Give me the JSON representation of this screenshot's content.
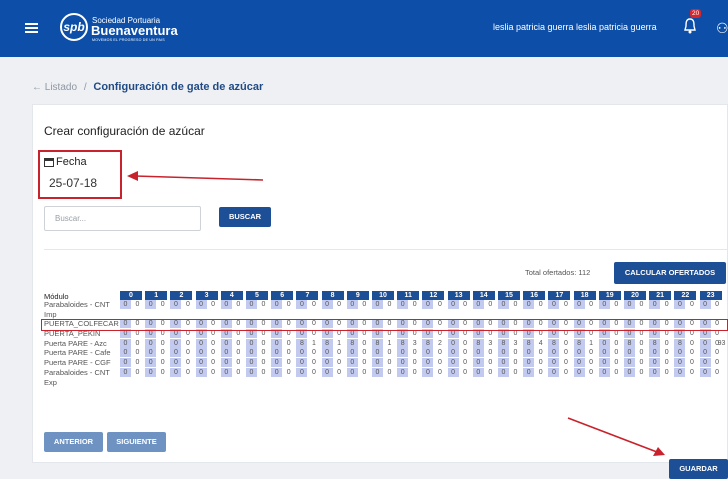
{
  "header": {
    "brand_line1": "Sociedad Portuaria",
    "brand_line2": "Buenaventura",
    "brand_tagline": "MOVEMOS EL PROGRESO DE UN PAIS",
    "logo_text": "spb",
    "user_name": "leslia patricia guerra leslia patricia guerra",
    "notif_count": "20"
  },
  "breadcrumb": {
    "back": "← Listado",
    "sep": "/",
    "current": "Configuración de gate de azúcar"
  },
  "form": {
    "title": "Crear configuración de azúcar",
    "fecha_label": "Fecha",
    "fecha_value": "25-07-18",
    "search_placeholder": "Buscar...",
    "search_button": "BUSCAR",
    "total_text": "Total ofertados: 112",
    "calc_button": "CALCULAR OFERTADOS",
    "prev_button": "ANTERIOR",
    "next_button": "SIGUIENTE",
    "save_button": "GUARDAR"
  },
  "grid": {
    "module_header": "Módulo",
    "hours": [
      "0",
      "1",
      "2",
      "3",
      "4",
      "5",
      "6",
      "7",
      "8",
      "9",
      "10",
      "11",
      "12",
      "13",
      "14",
      "15",
      "16",
      "17",
      "18",
      "19",
      "20",
      "21",
      "22",
      "23"
    ],
    "rows": [
      {
        "label": "Parabaloides - CNT\nImp",
        "values": [
          "0",
          "0",
          "0",
          "0",
          "0",
          "0",
          "0",
          "0",
          "0",
          "0",
          "0",
          "0",
          "0",
          "0",
          "0",
          "0",
          "0",
          "0",
          "0",
          "0",
          "0",
          "0",
          "0",
          "0",
          "0",
          "0",
          "0",
          "0",
          "0",
          "0",
          "0",
          "0",
          "0",
          "0",
          "0",
          "0",
          "0",
          "0",
          "0",
          "0",
          "0",
          "0",
          "0",
          "0",
          "0",
          "0",
          "0",
          "0"
        ]
      },
      {
        "label": "PUERTA_COLFECAR",
        "values": [
          "0",
          "0",
          "0",
          "0",
          "0",
          "0",
          "0",
          "0",
          "0",
          "0",
          "0",
          "0",
          "0",
          "0",
          "0",
          "0",
          "0",
          "0",
          "0",
          "0",
          "0",
          "0",
          "0",
          "0",
          "0",
          "0",
          "0",
          "0",
          "0",
          "0",
          "0",
          "0",
          "0",
          "0",
          "0",
          "0",
          "0",
          "0",
          "0",
          "0",
          "0",
          "0",
          "0",
          "0",
          "0",
          "0",
          "0",
          "0"
        ]
      },
      {
        "label": "PUERTA_PEKIN",
        "values": [
          "0",
          "0",
          "0",
          "0",
          "0",
          "0",
          "0",
          "0",
          "0",
          "0",
          "0",
          "0",
          "0",
          "0",
          "0",
          "0",
          "0",
          "0",
          "0",
          "0",
          "0",
          "0",
          "0",
          "0",
          "0",
          "0",
          "0",
          "0",
          "0",
          "0",
          "0",
          "0",
          "0",
          "0",
          "0",
          "0",
          "0",
          "0",
          "0",
          "0",
          "0",
          "0",
          "0",
          "0",
          "0",
          "0",
          "0",
          "0"
        ]
      },
      {
        "label": "Puerta PARE - Azc",
        "values": [
          "0",
          "0",
          "0",
          "0",
          "0",
          "0",
          "0",
          "0",
          "0",
          "0",
          "0",
          "0",
          "0",
          "0",
          "8",
          "1",
          "8",
          "1",
          "8",
          "0",
          "8",
          "1",
          "8",
          "3",
          "8",
          "2",
          "0",
          "0",
          "8",
          "3",
          "8",
          "3",
          "8",
          "4",
          "8",
          "0",
          "8",
          "1",
          "0",
          "0",
          "8",
          "0",
          "8",
          "0",
          "8",
          "0",
          "0",
          "0"
        ],
        "total": "93"
      },
      {
        "label": "Puerta PARE - Cafe",
        "values": [
          "0",
          "0",
          "0",
          "0",
          "0",
          "0",
          "0",
          "0",
          "0",
          "0",
          "0",
          "0",
          "0",
          "0",
          "0",
          "0",
          "0",
          "0",
          "0",
          "0",
          "0",
          "0",
          "0",
          "0",
          "0",
          "0",
          "0",
          "0",
          "0",
          "0",
          "0",
          "0",
          "0",
          "0",
          "0",
          "0",
          "0",
          "0",
          "0",
          "0",
          "0",
          "0",
          "0",
          "0",
          "0",
          "0",
          "0",
          "0"
        ]
      },
      {
        "label": "Puerta PARE - CGF",
        "values": [
          "0",
          "0",
          "0",
          "0",
          "0",
          "0",
          "0",
          "0",
          "0",
          "0",
          "0",
          "0",
          "0",
          "0",
          "0",
          "0",
          "0",
          "0",
          "0",
          "0",
          "0",
          "0",
          "0",
          "0",
          "0",
          "0",
          "0",
          "0",
          "0",
          "0",
          "0",
          "0",
          "0",
          "0",
          "0",
          "0",
          "0",
          "0",
          "0",
          "0",
          "0",
          "0",
          "0",
          "0",
          "0",
          "0",
          "0",
          "0"
        ]
      },
      {
        "label": "Parabaloides - CNT\nExp",
        "values": [
          "0",
          "0",
          "0",
          "0",
          "0",
          "0",
          "0",
          "0",
          "0",
          "0",
          "0",
          "0",
          "0",
          "0",
          "0",
          "0",
          "0",
          "0",
          "0",
          "0",
          "0",
          "0",
          "0",
          "0",
          "0",
          "0",
          "0",
          "0",
          "0",
          "0",
          "0",
          "0",
          "0",
          "0",
          "0",
          "0",
          "0",
          "0",
          "0",
          "0",
          "0",
          "0",
          "0",
          "0",
          "0",
          "0",
          "0",
          "0"
        ]
      }
    ]
  },
  "colors": {
    "primary": "#1d4f97",
    "topbar": "#0d4fa8",
    "highlight": "#c8232c",
    "cell_fill": "#c3caf0"
  }
}
